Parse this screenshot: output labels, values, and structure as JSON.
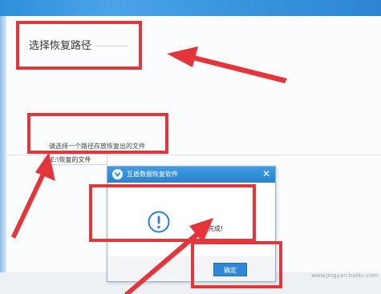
{
  "main": {
    "section_title": "选择恢复路径",
    "path_hint": "请选择一个路径存放恢复出的文件",
    "path_value": "E:\\恢复的文件"
  },
  "dialog": {
    "title": "互盾数据恢复软件",
    "close_glyph": "✕",
    "message": "恢复完成!",
    "ok_label": "确定",
    "icon": "exclamation-circle-icon"
  },
  "watermark": "www.jingyan.baidu.com",
  "colors": {
    "annotation_red": "#e4353c",
    "title_bar_blue": "#2f87d6",
    "button_blue": "#2f87d6"
  }
}
